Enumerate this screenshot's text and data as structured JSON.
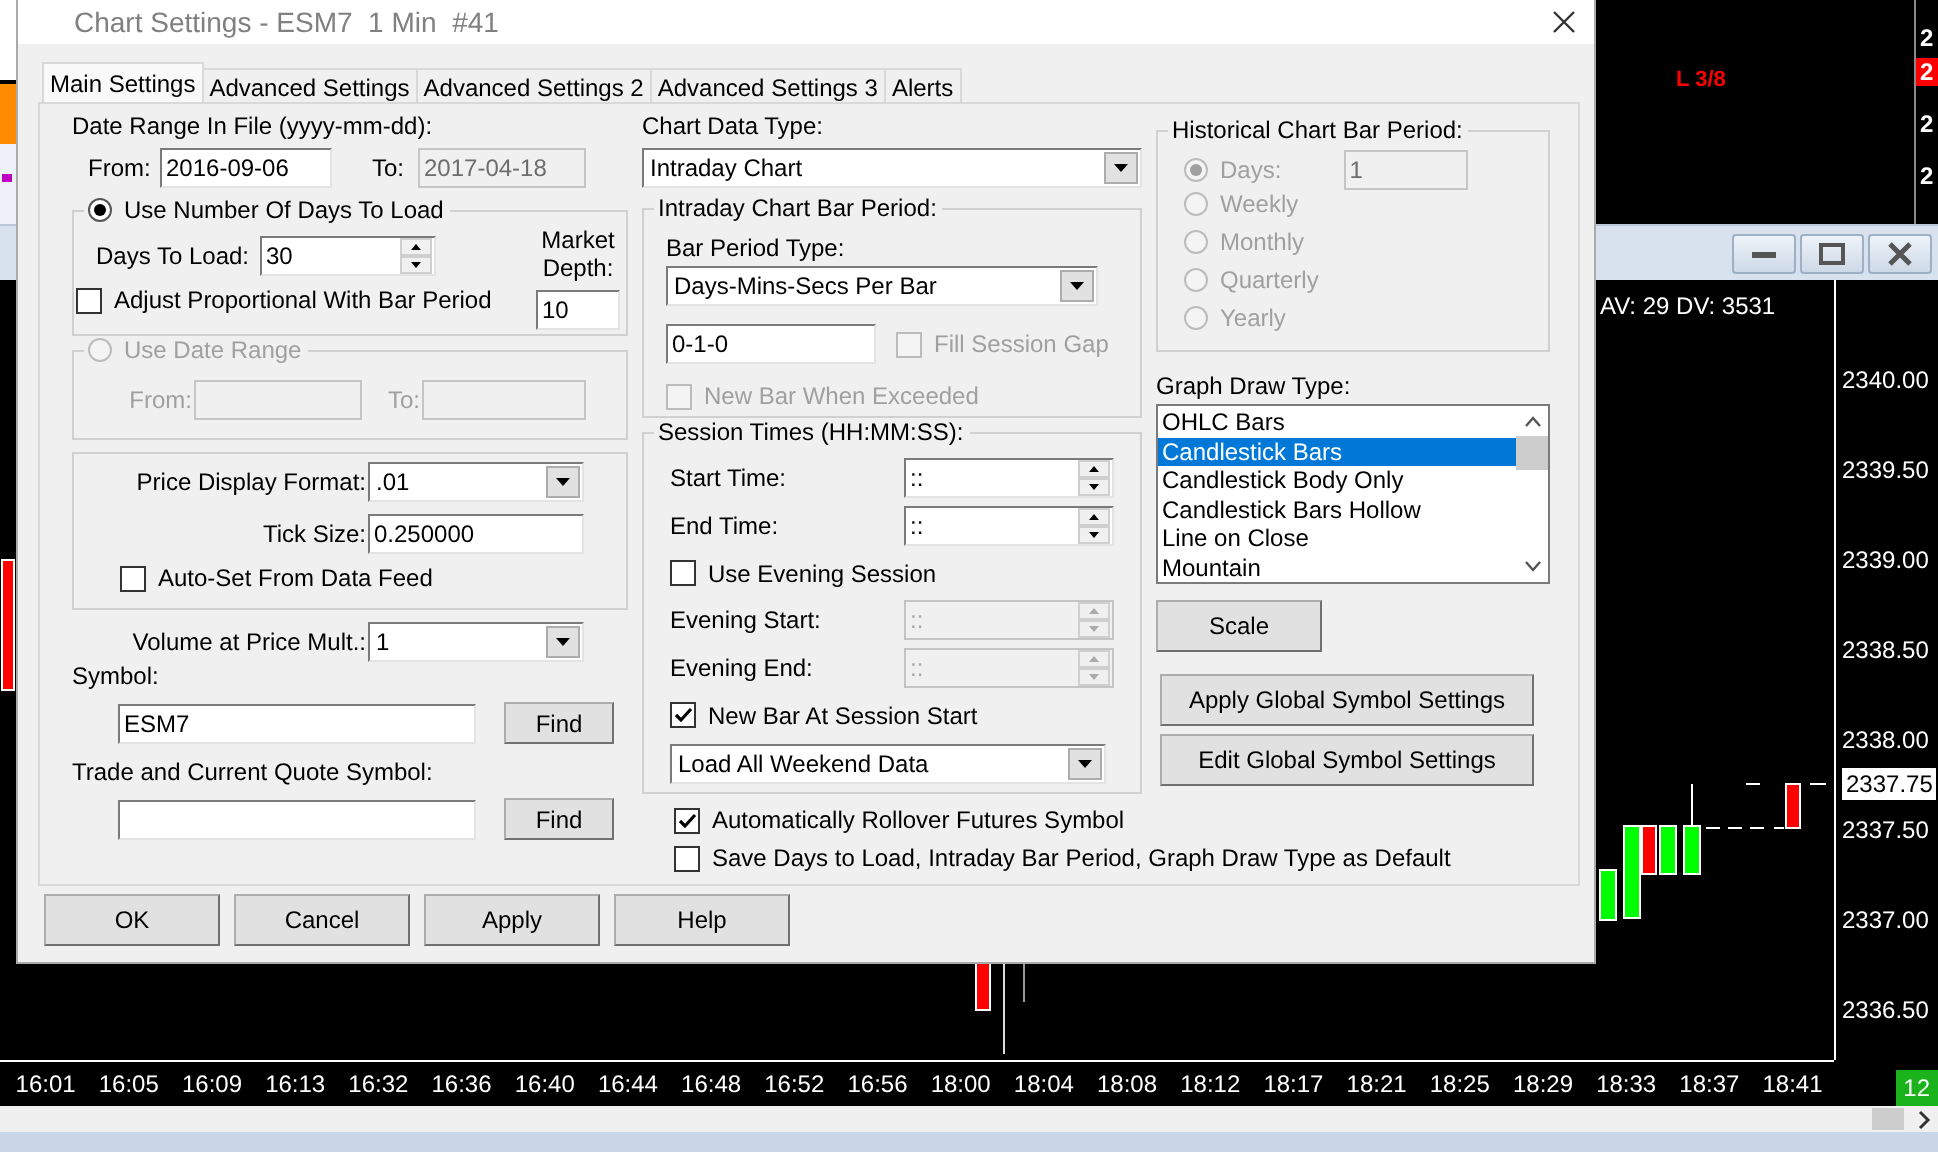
{
  "background_chart": {
    "label": "L 3/8",
    "axis_labels": [
      {
        "text": "2",
        "highlighted": false
      },
      {
        "text": "2",
        "highlighted": true
      },
      {
        "text": "2",
        "highlighted": false
      },
      {
        "text": "2",
        "highlighted": false
      }
    ]
  },
  "chart_window": {
    "info": "AV: 29 DV: 3531",
    "bar_count": "12",
    "price_labels": [
      {
        "text": "2340.00",
        "highlighted": false
      },
      {
        "text": "2339.50",
        "highlighted": false
      },
      {
        "text": "2339.00",
        "highlighted": false
      },
      {
        "text": "2338.50",
        "highlighted": false
      },
      {
        "text": "2338.00",
        "highlighted": false
      },
      {
        "text": "2337.75",
        "highlighted": true
      },
      {
        "text": "2337.50",
        "highlighted": false
      },
      {
        "text": "2337.00",
        "highlighted": false
      },
      {
        "text": "2336.50",
        "highlighted": false
      }
    ],
    "time_labels": [
      "16:01",
      "16:05",
      "16:09",
      "16:13",
      "16:32",
      "16:36",
      "16:40",
      "16:44",
      "16:48",
      "16:52",
      "16:56",
      "18:00",
      "18:04",
      "18:08",
      "18:12",
      "18:17",
      "18:21",
      "18:25",
      "18:29",
      "18:33",
      "18:37",
      "18:41"
    ]
  },
  "dialog": {
    "title": "Chart Settings - ESM7  1 Min  #41"
  },
  "tabs": [
    {
      "label": "Main Settings",
      "selected": true
    },
    {
      "label": "Advanced Settings",
      "selected": false
    },
    {
      "label": "Advanced Settings 2",
      "selected": false
    },
    {
      "label": "Advanced Settings 3",
      "selected": false
    },
    {
      "label": "Alerts",
      "selected": false
    }
  ],
  "date_range": {
    "label": "Date Range In File (yyyy-mm-dd):",
    "from_label": "From:",
    "from": {
      "value": "2016-09-06",
      "readonly": false
    },
    "to_label": "To:",
    "to": {
      "value": "2017-04-18",
      "readonly": true
    }
  },
  "days_group": {
    "label": "Use Number Of Days To Load",
    "selected": true,
    "days_label": "Days To Load:",
    "days": "30",
    "adjust": {
      "label": "Adjust Proportional With Bar Period",
      "checked": false
    },
    "depth_label": "Market Depth:",
    "depth": "10"
  },
  "date_group": {
    "label": "Use Date Range",
    "selected": false,
    "disabled": true,
    "from_label": "From:",
    "to_label": "To:"
  },
  "price_group": {
    "format_label": "Price Display Format:",
    "format": ".01",
    "tick_label": "Tick Size:",
    "tick": "0.250000",
    "auto_set": {
      "label": "Auto-Set From Data Feed",
      "checked": false
    }
  },
  "volume": {
    "label": "Volume at Price Mult.:",
    "value": "1"
  },
  "symbol": {
    "label": "Symbol:",
    "value": "ESM7",
    "button": "Find"
  },
  "quote_symbol": {
    "label": "Trade and Current Quote Symbol:",
    "button": "Find"
  },
  "chart_data_type": {
    "label": "Chart Data Type:",
    "value": "Intraday Chart"
  },
  "intraday_period": {
    "label": "Intraday Chart Bar Period:",
    "type_label": "Bar Period Type:",
    "type": "Days-Mins-Secs Per Bar",
    "value": "0-1-0",
    "fill_gap": {
      "label": "Fill Session Gap",
      "checked": false,
      "disabled": true
    },
    "new_bar_exceeded": {
      "label": "New Bar When Exceeded",
      "checked": false,
      "disabled": true
    }
  },
  "session_times": {
    "label": "Session Times (HH:MM:SS):",
    "items": [
      {
        "kind": "time",
        "label": "Start Time:",
        "value": "::",
        "disabled": false
      },
      {
        "kind": "time",
        "label": "End Time:",
        "value": "::",
        "disabled": false
      },
      {
        "kind": "checkbox",
        "label": "Use Evening Session",
        "checked": false
      },
      {
        "kind": "time",
        "label": "Evening Start:",
        "value": "::",
        "disabled": true
      },
      {
        "kind": "time",
        "label": "Evening End:",
        "value": "::",
        "disabled": true
      },
      {
        "kind": "checkbox",
        "label": "New Bar At Session Start",
        "checked": true
      },
      {
        "kind": "dropdown",
        "value": "Load All Weekend Data"
      }
    ]
  },
  "options": [
    {
      "label": "Automatically Rollover Futures Symbol",
      "checked": true
    },
    {
      "label": "Save Days to Load, Intraday Bar Period, Graph Draw Type as Default",
      "checked": false
    }
  ],
  "historical_period": {
    "label": "Historical Chart Bar Period:",
    "disabled": true,
    "days_value": "1",
    "options": [
      {
        "label": "Days:",
        "selected": true
      },
      {
        "label": "Weekly",
        "selected": false
      },
      {
        "label": "Monthly",
        "selected": false
      },
      {
        "label": "Quarterly",
        "selected": false
      },
      {
        "label": "Yearly",
        "selected": false
      }
    ]
  },
  "graph_draw_type": {
    "label": "Graph Draw Type:",
    "items": [
      {
        "label": "OHLC Bars",
        "selected": false
      },
      {
        "label": "Candlestick Bars",
        "selected": true
      },
      {
        "label": "Candlestick Body Only",
        "selected": false
      },
      {
        "label": "Candlestick Bars Hollow",
        "selected": false
      },
      {
        "label": "Line on Close",
        "selected": false
      },
      {
        "label": "Mountain",
        "selected": false
      }
    ]
  },
  "scale_button": "Scale",
  "global_buttons": [
    "Apply Global Symbol Settings",
    "Edit Global Symbol Settings"
  ],
  "buttons": [
    "OK",
    "Cancel",
    "Apply",
    "Help"
  ]
}
